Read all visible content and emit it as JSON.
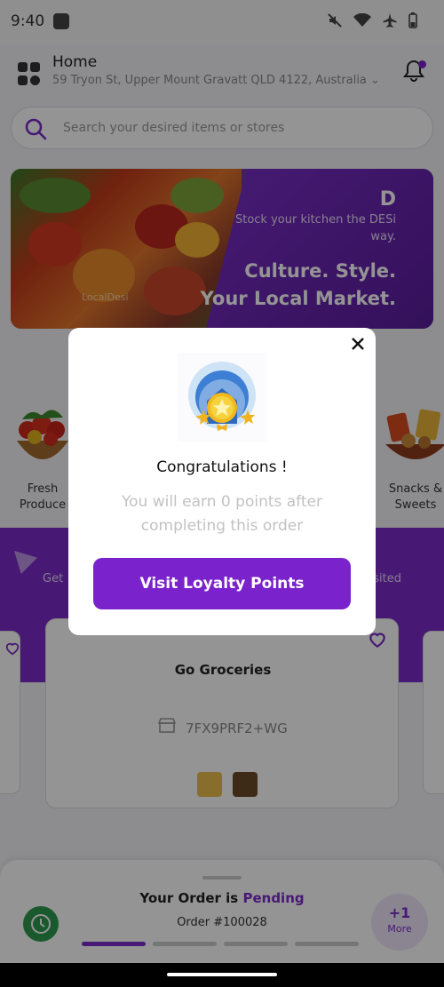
{
  "status_bar": {
    "time": "9:40"
  },
  "header": {
    "title": "Home",
    "address": "59 Tryon St, Upper Mount Gravatt QLD 4122, Australia"
  },
  "search": {
    "placeholder": "Search your desired items or stores"
  },
  "banner": {
    "tagline": "Stock your kitchen the DESi way.",
    "headline_line1": "Culture. Style.",
    "headline_line2": "Your Local Market.",
    "watermark": "LocalDesi"
  },
  "categories": [
    {
      "label_line1": "Fresh",
      "label_line2": "Produce"
    },
    {
      "label_line1": "Snacks &",
      "label_line2": "Sweets"
    }
  ],
  "promo_band": {
    "left_text": "Get",
    "right_text": "sited"
  },
  "store_card": {
    "name": "Go Groceries",
    "plus_code": "7FX9PRF2+WG"
  },
  "order_sheet": {
    "title_prefix": "Your Order is",
    "status": "Pending",
    "order_number": "Order #100028",
    "more_count": "+1",
    "more_label": "More",
    "progress_steps_total": 4,
    "progress_steps_done": 1
  },
  "dialog": {
    "title": "Congratulations !",
    "message": "You will earn 0 points after completing this order",
    "button_label": "Visit Loyalty Points"
  },
  "colors": {
    "brand_purple": "#7a22cc",
    "status_green": "#2e9a4e"
  }
}
